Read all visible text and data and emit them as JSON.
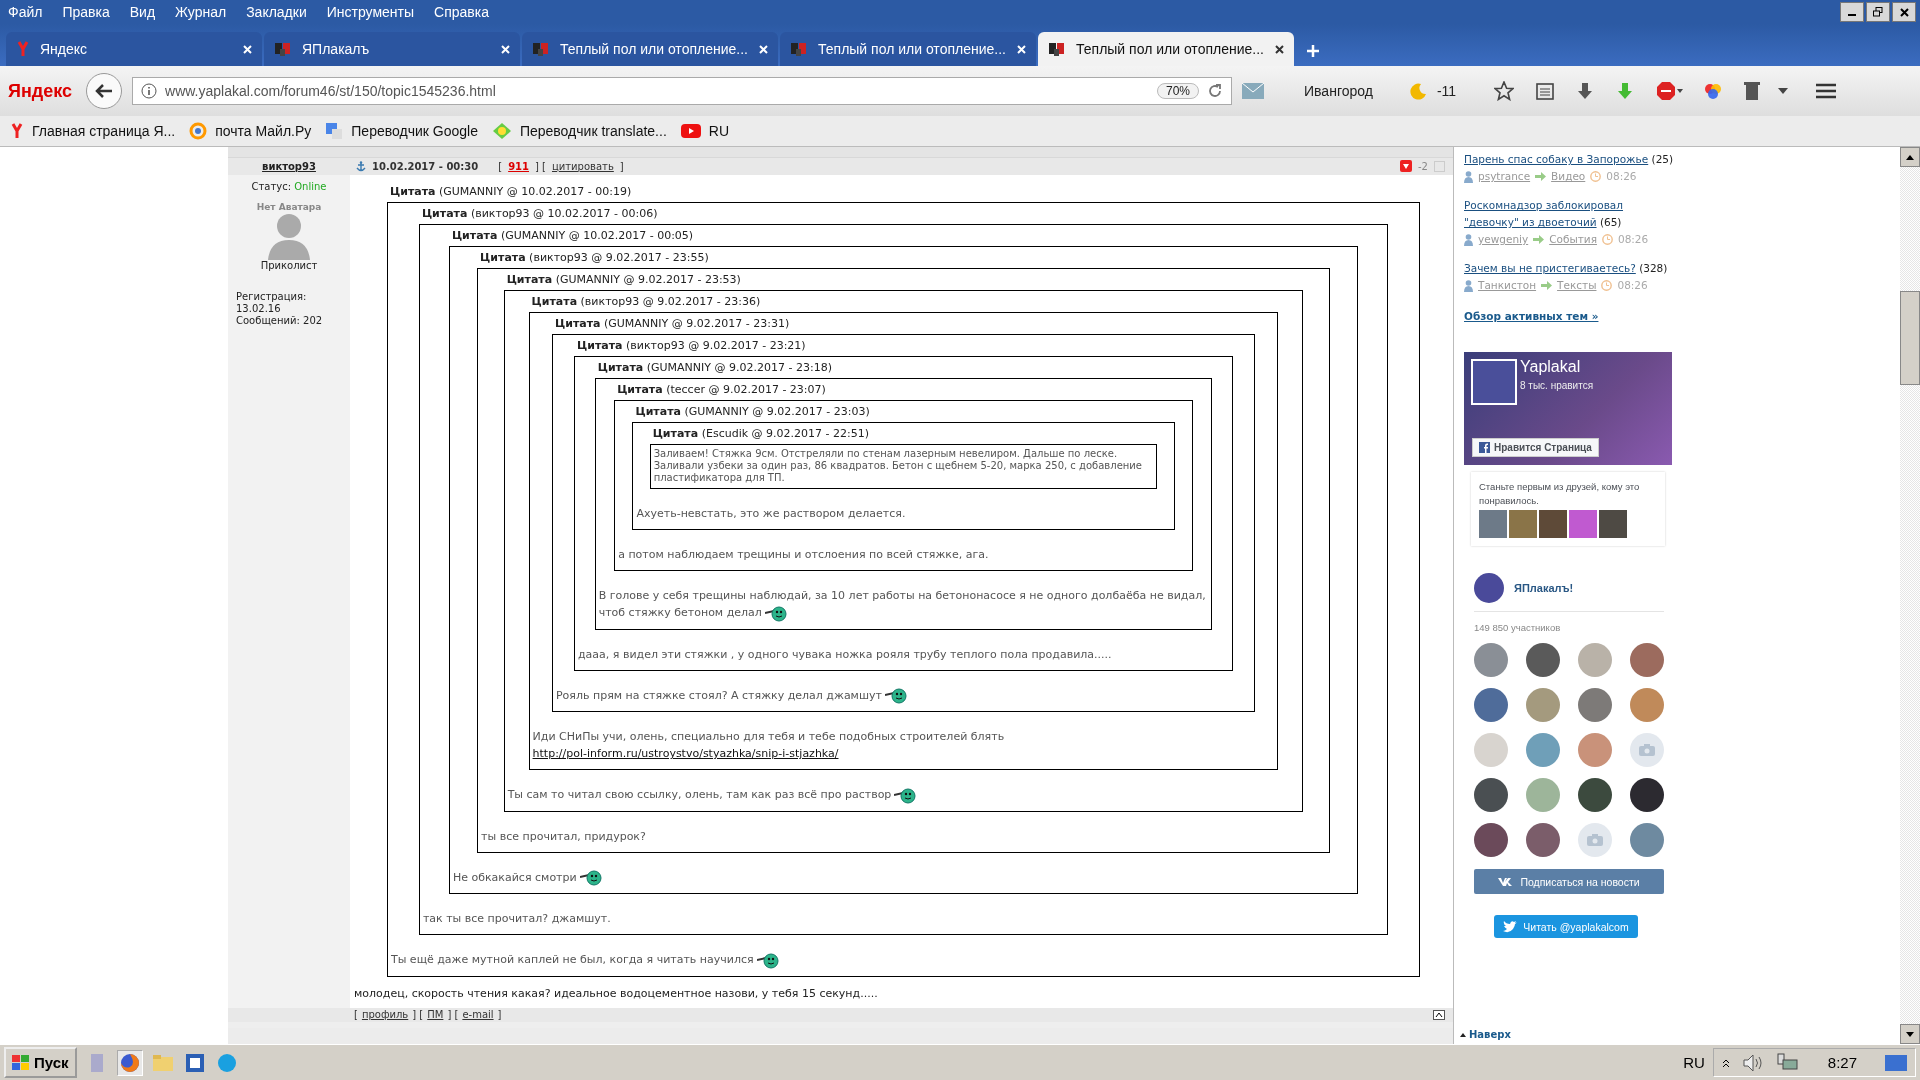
{
  "menu": [
    "Файл",
    "Правка",
    "Вид",
    "Журнал",
    "Закладки",
    "Инструменты",
    "Справка"
  ],
  "tabs": [
    {
      "title": "Яндекс",
      "selected": false,
      "kind": "yandex"
    },
    {
      "title": "ЯПлакалъ",
      "selected": false,
      "kind": "site"
    },
    {
      "title": "Теплый пол или отопление...",
      "selected": false,
      "kind": "site"
    },
    {
      "title": "Теплый пол или отопление...",
      "selected": false,
      "kind": "site"
    },
    {
      "title": "Теплый пол или отопление...",
      "selected": true,
      "kind": "site"
    }
  ],
  "toolbar": {
    "brand": "Яндекс",
    "url": "www.yaplakal.com/forum46/st/150/topic1545236.html",
    "zoom": "70%",
    "city": "Ивангород",
    "temperature": "-11"
  },
  "bookmarks": [
    {
      "label": "Главная страница Я...",
      "kind": "yandex"
    },
    {
      "label": "почта Майл.Ру",
      "kind": "mail"
    },
    {
      "label": "Переводчик Google",
      "kind": "google"
    },
    {
      "label": "Переводчик translate...",
      "kind": "translate"
    },
    {
      "label": "RU",
      "kind": "video"
    }
  ],
  "post": {
    "author": "виктор93",
    "status_label": "Статус:",
    "status": "Online",
    "avatar_caption": "Нет Аватара",
    "rank": "Приколист",
    "registration_label": "Регистрация:",
    "registration": "13.02.16",
    "messages": "Сообщений: 202",
    "date": "10.02.2017 - 00:30",
    "header_links": [
      {
        "text": "[",
        "kind": "text"
      },
      {
        "text": "911",
        "kind": "number"
      },
      {
        "text": "] [",
        "kind": "text"
      },
      {
        "text": "цитировать",
        "kind": "link"
      },
      {
        "text": "]",
        "kind": "text"
      }
    ],
    "rating": "-2",
    "quote": {
      "header": "**Цитата** (GUMANNIY @ 10.02.2017 - 00:19)",
      "reply": "Ты ещё даже мутной каплей не был, когда я читать научился",
      "smiley": true,
      "quote": {
        "header": "**Цитата** (виктор93 @ 10.02.2017 - 00:06)",
        "reply": "так ты все прочитал? джамшут.",
        "smiley": false,
        "quote": {
          "header": "**Цитата** (GUMANNIY @ 10.02.2017 - 00:05)",
          "reply": "Не обкакайся смотри",
          "smiley": true,
          "quote": {
            "header": "**Цитата** (виктор93 @ 9.02.2017 - 23:55)",
            "reply": "ты все прочитал, придурок?",
            "smiley": false,
            "quote": {
              "header": "**Цитата** (GUMANNIY @ 9.02.2017 - 23:53)",
              "reply": "Ты сам то читал свою ссылку, олень, там как раз всё про раствор",
              "smiley": true,
              "quote": {
                "header": "**Цитата** (виктор93 @ 9.02.2017 - 23:36)",
                "reply": "Иди СНиПы учи, олень, специально для тебя и тебе подобных строителей блять",
                "link": "http://pol-inform.ru/ustroystvo/styazhka/snip-i-stjazhka/",
                "smiley": false,
                "quote": {
                  "header": "**Цитата** (GUMANNIY @ 9.02.2017 - 23:31)",
                  "reply": "Рояль прям на стяжке стоял? А стяжку делал джамшут",
                  "smiley": true,
                  "quote": {
                    "header": "**Цитата** (виктор93 @ 9.02.2017 - 23:21)",
                    "reply": "дааа, я видел эти стяжки , у одного чувака ножка рояля трубу теплого пола продавила.....",
                    "smiley": false,
                    "quote": {
                      "header": "**Цитата** (GUMANNIY @ 9.02.2017 - 23:18)",
                      "reply": "В голове у себя трещины наблюдай, за 10 лет работы на бетононасосе я не одного долбаёба не видал, чтоб стяжку бетоном делал",
                      "smiley": true,
                      "quote": {
                        "header": "**Цитата** (teccer @ 9.02.2017 - 23:07)",
                        "reply": "а потом наблюдаем трещины и отслоения по всей стяжке, ага.",
                        "smiley": false,
                        "quote": {
                          "header": "**Цитата** (GUMANNIY @ 9.02.2017 - 23:03)",
                          "reply": "Ахуеть-невстать, это же раствором делается.",
                          "smiley": false,
                          "quote": {
                            "header": "**Цитата** (Escudik @ 9.02.2017 - 22:51)",
                            "text": "Заливаем! Стяжка 9см. Отстреляли по стенам лазерным невелиром. Дальше по леске. Заливали узбеки за один раз, 86 квадратов. Бетон с щебнем 5-20, марка 250, с добавление пластификатора для ТП."
                          }
                        }
                      }
                    }
                  }
                }
              }
            }
          }
        }
      }
    },
    "text": "молодец, скорость чтения какая? идеальное водоцементное назови, у тебя 15 секунд.....",
    "footer_links": [
      {
        "text": "[",
        "kind": "text"
      },
      {
        "text": "профиль",
        "kind": "link"
      },
      {
        "text": "] [",
        "kind": "text"
      },
      {
        "text": "ПМ",
        "kind": "link"
      },
      {
        "text": "] [",
        "kind": "text"
      },
      {
        "text": "e-mail",
        "kind": "link"
      },
      {
        "text": "]",
        "kind": "text"
      }
    ]
  },
  "sidebar": {
    "topics": [
      {
        "title": "Парень спас собаку в Запорожье",
        "count": "(25)",
        "user": "psytrance",
        "category": "Видео",
        "time": "08:26"
      },
      {
        "title": "Роскомнадзор заблокировал \"девочку\" из двоеточий",
        "count": "(65)",
        "user": "yewgeniy",
        "category": "События",
        "time": "08:26"
      },
      {
        "title": "Зачем вы не пристегиваетесь?",
        "count": "(328)",
        "user": "Танкистон",
        "category": "Тексты",
        "time": "08:26"
      }
    ],
    "more": "Обзор активных тем »",
    "facebook": {
      "name": "Yaplakal",
      "likes": "8 тыс. нравится",
      "like_button": "Нравится Страница",
      "prompt": "Станьте первым из друзей, кому это понравилось."
    },
    "vk": {
      "name": "ЯПлакалъ!",
      "members": "149 850 участников",
      "avatars": [
        {
          "kind": "photo"
        },
        {
          "kind": "photo"
        },
        {
          "kind": "photo"
        },
        {
          "kind": "photo"
        },
        {
          "kind": "photo"
        },
        {
          "kind": "photo"
        },
        {
          "kind": "photo"
        },
        {
          "kind": "photo"
        },
        {
          "kind": "photo"
        },
        {
          "kind": "photo"
        },
        {
          "kind": "photo"
        },
        {
          "kind": "camera"
        },
        {
          "kind": "photo"
        },
        {
          "kind": "photo"
        },
        {
          "kind": "photo"
        },
        {
          "kind": "photo"
        },
        {
          "kind": "photo"
        },
        {
          "kind": "photo"
        },
        {
          "kind": "camera"
        },
        {
          "kind": "photo"
        }
      ],
      "subscribe": "Подписаться на новости"
    },
    "twitter": "Читать @yaplakalcom",
    "to_top": "Наверх"
  },
  "taskbar": {
    "start": "Пуск",
    "language": "RU",
    "clock": "8:27"
  }
}
